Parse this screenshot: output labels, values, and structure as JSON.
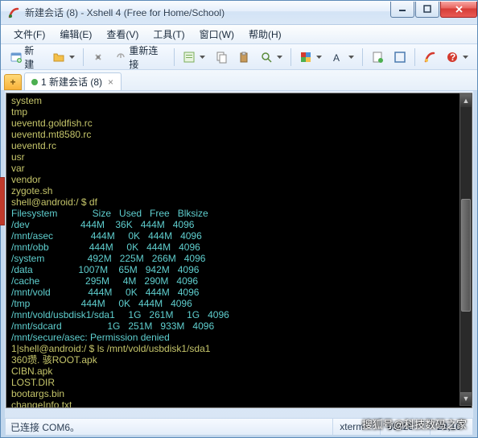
{
  "window": {
    "title": "新建会话 (8) - Xshell 4 (Free for Home/School)"
  },
  "menu": {
    "file": "文件(F)",
    "edit": "编辑(E)",
    "view": "查看(V)",
    "tools": "工具(T)",
    "window": "窗口(W)",
    "help": "帮助(H)"
  },
  "toolbar": {
    "new_label": "新建",
    "reconnect_label": "重新连接"
  },
  "tabs": {
    "active": "1 新建会话 (8)"
  },
  "terminal_lines": [
    {
      "t": "system"
    },
    {
      "t": "tmp"
    },
    {
      "t": "ueventd.goldfish.rc"
    },
    {
      "t": "ueventd.mt8580.rc"
    },
    {
      "t": "ueventd.rc"
    },
    {
      "t": "usr"
    },
    {
      "t": "var"
    },
    {
      "t": "vendor"
    },
    {
      "t": "zygote.sh"
    },
    {
      "t": "shell@android:/ $ df"
    },
    {
      "t": "Filesystem             Size   Used   Free   Blksize",
      "c": "cy"
    },
    {
      "t": "/dev                   444M    36K   444M   4096",
      "c": "cy"
    },
    {
      "t": "/mnt/asec              444M     0K   444M   4096",
      "c": "cy"
    },
    {
      "t": "/mnt/obb               444M     0K   444M   4096",
      "c": "cy"
    },
    {
      "t": "/system                492M   225M   266M   4096",
      "c": "cy"
    },
    {
      "t": "/data                 1007M    65M   942M   4096",
      "c": "cy"
    },
    {
      "t": "/cache                 295M     4M   290M   4096",
      "c": "cy"
    },
    {
      "t": "/mnt/vold              444M     0K   444M   4096",
      "c": "cy"
    },
    {
      "t": "/tmp                   444M     0K   444M   4096",
      "c": "cy"
    },
    {
      "t": "/mnt/vold/usbdisk1/sda1     1G   261M     1G   4096",
      "c": "cy"
    },
    {
      "t": "/mnt/sdcard                 1G   251M   933M   4096",
      "c": "cy"
    },
    {
      "t": "/mnt/secure/asec: Permission denied",
      "c": "cy"
    },
    {
      "t": "1|shell@android:/ $ ls /mnt/vold/usbdisk1/sda1"
    },
    {
      "t": "360瓒. 骇ROOT.apk"
    },
    {
      "t": "CIBN.apk"
    },
    {
      "t": "LOST.DIR"
    },
    {
      "t": "bootargs.bin"
    },
    {
      "t": "changeInfo.txt"
    }
  ],
  "status": {
    "conn": "已连接 COM6。",
    "term": "xterm",
    "size": "69x28",
    "pos": "28,10"
  },
  "watermark": "搜狐号@科技数码之家"
}
